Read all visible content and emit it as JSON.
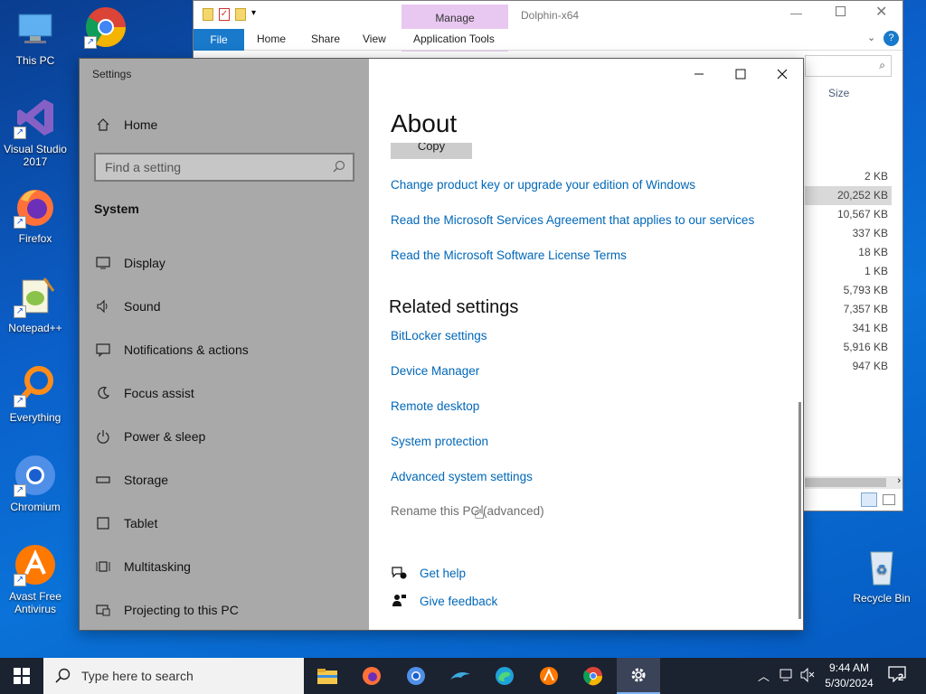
{
  "desktop": {
    "icons": [
      {
        "label": "This PC"
      },
      {
        "label": "Google Chrome"
      },
      {
        "label": "Visual Studio 2017"
      },
      {
        "label": "Firefox"
      },
      {
        "label": "Notepad++"
      },
      {
        "label": "Everything"
      },
      {
        "label": "Chromium"
      },
      {
        "label": "Avast Free Antivirus"
      },
      {
        "label": "Recycle Bin"
      }
    ]
  },
  "explorer": {
    "title": "Dolphin-x64",
    "manage_label": "Manage",
    "tabs": [
      "File",
      "Home",
      "Share",
      "View",
      "Application Tools"
    ],
    "size_header": "Size",
    "sizes": [
      "2 KB",
      "20,252 KB",
      "10,567 KB",
      "337 KB",
      "18 KB",
      "1 KB",
      "5,793 KB",
      "7,357 KB",
      "341 KB",
      "5,916 KB",
      "947 KB"
    ]
  },
  "settings": {
    "window_title": "Settings",
    "sidebar": {
      "home_label": "Home",
      "search_placeholder": "Find a setting",
      "section_label": "System",
      "items": [
        {
          "label": "Display",
          "icon": "display-icon"
        },
        {
          "label": "Sound",
          "icon": "sound-icon"
        },
        {
          "label": "Notifications & actions",
          "icon": "notifications-icon"
        },
        {
          "label": "Focus assist",
          "icon": "focus-assist-icon"
        },
        {
          "label": "Power & sleep",
          "icon": "power-icon"
        },
        {
          "label": "Storage",
          "icon": "storage-icon"
        },
        {
          "label": "Tablet",
          "icon": "tablet-icon"
        },
        {
          "label": "Multitasking",
          "icon": "multitasking-icon"
        },
        {
          "label": "Projecting to this PC",
          "icon": "projecting-icon"
        }
      ]
    },
    "content": {
      "title": "About",
      "copy_label": "Copy",
      "links": [
        "Change product key or upgrade your edition of Windows",
        "Read the Microsoft Services Agreement that applies to our services",
        "Read the Microsoft Software License Terms"
      ],
      "related_title": "Related settings",
      "related_links": [
        "BitLocker settings",
        "Device Manager",
        "Remote desktop",
        "System protection",
        "Advanced system settings"
      ],
      "rename_label": "Rename this PC (advanced)",
      "get_help": "Get help",
      "give_feedback": "Give feedback"
    }
  },
  "taskbar": {
    "search_placeholder": "Type here to search",
    "time": "9:44 AM",
    "date": "5/30/2024",
    "notification_count": "2"
  },
  "colors": {
    "link": "#0067b8",
    "sidebar_bg": "#a9a9a9",
    "taskbar_bg": "#1b2230"
  }
}
